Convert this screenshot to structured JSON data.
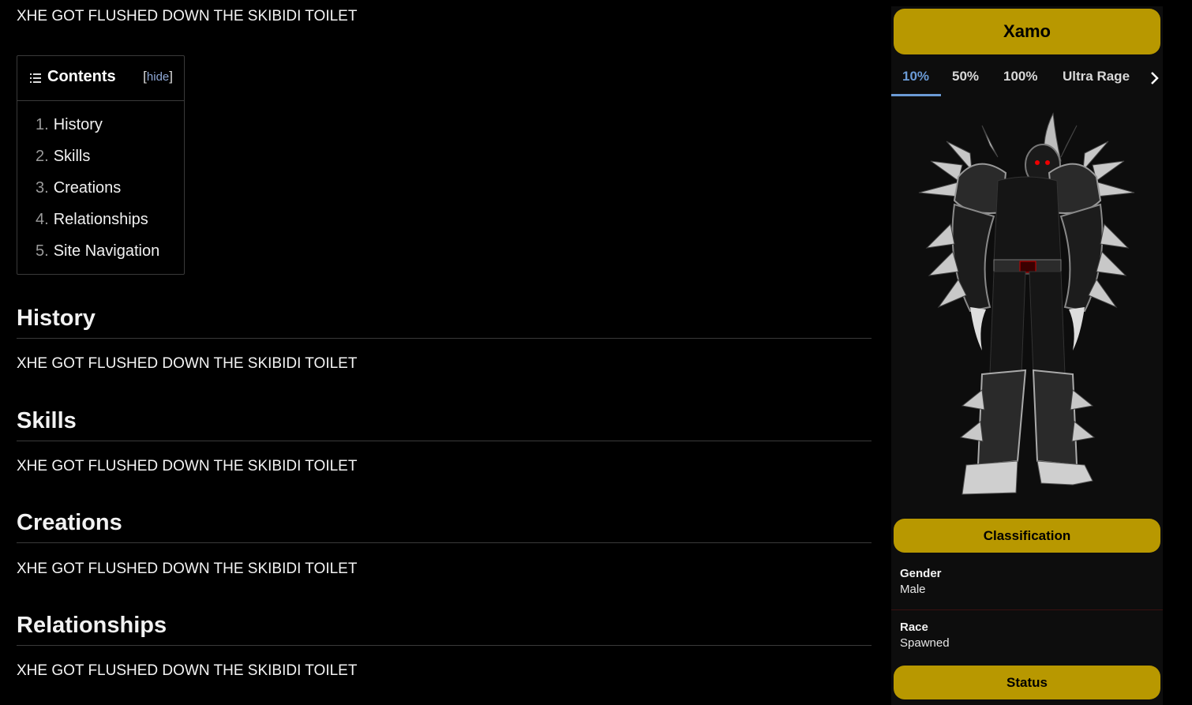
{
  "intro_text": "XHE GOT FLUSHED DOWN THE SKIBIDI TOILET",
  "toc": {
    "title": "Contents",
    "hide_open": "[",
    "hide_label": "hide",
    "hide_close": "]",
    "items": [
      {
        "num": "1.",
        "label": "History"
      },
      {
        "num": "2.",
        "label": "Skills"
      },
      {
        "num": "3.",
        "label": "Creations"
      },
      {
        "num": "4.",
        "label": "Relationships"
      },
      {
        "num": "5.",
        "label": "Site Navigation"
      }
    ]
  },
  "sections": [
    {
      "heading": "History",
      "body": "XHE GOT FLUSHED DOWN THE SKIBIDI TOILET"
    },
    {
      "heading": "Skills",
      "body": "XHE GOT FLUSHED DOWN THE SKIBIDI TOILET"
    },
    {
      "heading": "Creations",
      "body": "XHE GOT FLUSHED DOWN THE SKIBIDI TOILET"
    },
    {
      "heading": "Relationships",
      "body": "XHE GOT FLUSHED DOWN THE SKIBIDI TOILET"
    }
  ],
  "infobox": {
    "title": "Xamo",
    "tabs": [
      "10%",
      "50%",
      "100%",
      "Ultra Rage"
    ],
    "active_tab": "10%",
    "image_icon": "armored-character-image",
    "classification_heading": "Classification",
    "fields": [
      {
        "label": "Gender",
        "value": "Male"
      },
      {
        "label": "Race",
        "value": "Spawned"
      }
    ],
    "status_heading": "Status"
  },
  "colors": {
    "background": "#000000",
    "accent_gold": "#b89800",
    "tab_active": "#6b9bd6",
    "link": "#8fa8d6"
  }
}
